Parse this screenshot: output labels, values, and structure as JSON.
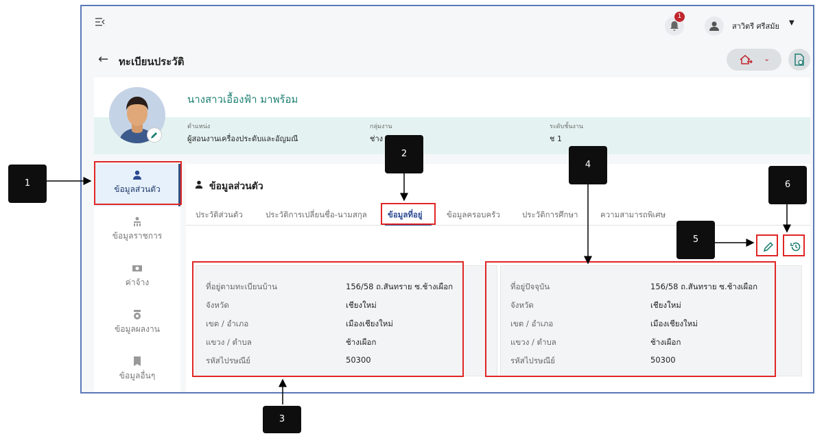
{
  "topbar": {
    "menu_icon": "menu-collapse-icon",
    "notification_count": "1",
    "user_name": "สาวิตรี ศรีสมัย"
  },
  "header": {
    "title": "ทะเบียนประวัติ"
  },
  "profile": {
    "name": "นางสาวเอื้องฟ้า มาพร้อม",
    "fields": [
      {
        "label": "ตำแหน่ง",
        "value": "ผู้สอนงานเครื่องประดับและอัญมณี"
      },
      {
        "label": "กลุ่มงาน",
        "value": "ช่าง"
      },
      {
        "label": "ระดับชั้นงาน",
        "value": "ช 1"
      }
    ]
  },
  "sidenav": {
    "items": [
      {
        "label": "ข้อมูลส่วนตัว",
        "icon": "person-icon",
        "active": true
      },
      {
        "label": "ข้อมูลราชการ",
        "icon": "org-icon"
      },
      {
        "label": "ค่าจ้าง",
        "icon": "money-icon"
      },
      {
        "label": "ข้อมูลผลงาน",
        "icon": "medal-icon"
      },
      {
        "label": "ข้อมูลอื่นๆ",
        "icon": "bookmark-icon"
      }
    ]
  },
  "main": {
    "section_title": "ข้อมูลส่วนตัว",
    "tabs": [
      {
        "label": "ประวัติส่วนตัว"
      },
      {
        "label": "ประวัติการเปลี่ยนชื่อ-นามสกุล"
      },
      {
        "label": "ข้อมูลที่อยู่",
        "active": true
      },
      {
        "label": "ข้อมูลครอบครัว"
      },
      {
        "label": "ประวัติการศึกษา"
      },
      {
        "label": "ความสามารถพิเศษ"
      }
    ],
    "registered_address": {
      "rows": [
        {
          "label": "ที่อยู่ตามทะเบียนบ้าน",
          "value": "156/58 ถ.สันทราย ซ.ช้างเผือก"
        },
        {
          "label": "จังหวัด",
          "value": "เชียงใหม่"
        },
        {
          "label": "เขต / อำเภอ",
          "value": "เมืองเชียงใหม่"
        },
        {
          "label": "แขวง / ตำบล",
          "value": "ช้างเผือก"
        },
        {
          "label": "รหัสไปรษณีย์",
          "value": "50300"
        }
      ]
    },
    "current_address": {
      "rows": [
        {
          "label": "ที่อยู่ปัจจุบัน",
          "value": "156/58 ถ.สันทราย ซ.ช้างเผือก"
        },
        {
          "label": "จังหวัด",
          "value": "เชียงใหม่"
        },
        {
          "label": "เขต / อำเภอ",
          "value": "เมืองเชียงใหม่"
        },
        {
          "label": "แขวง / ตำบล",
          "value": "ช้างเผือก"
        },
        {
          "label": "รหัสไปรษณีย์",
          "value": "50300"
        }
      ]
    }
  },
  "callouts": [
    "1",
    "2",
    "3",
    "4",
    "5",
    "6"
  ],
  "colors": {
    "accent": "#2b4a92",
    "name_teal": "#1d7f72",
    "annotation_red": "#e02424",
    "frame_blue": "#5a77b8"
  }
}
